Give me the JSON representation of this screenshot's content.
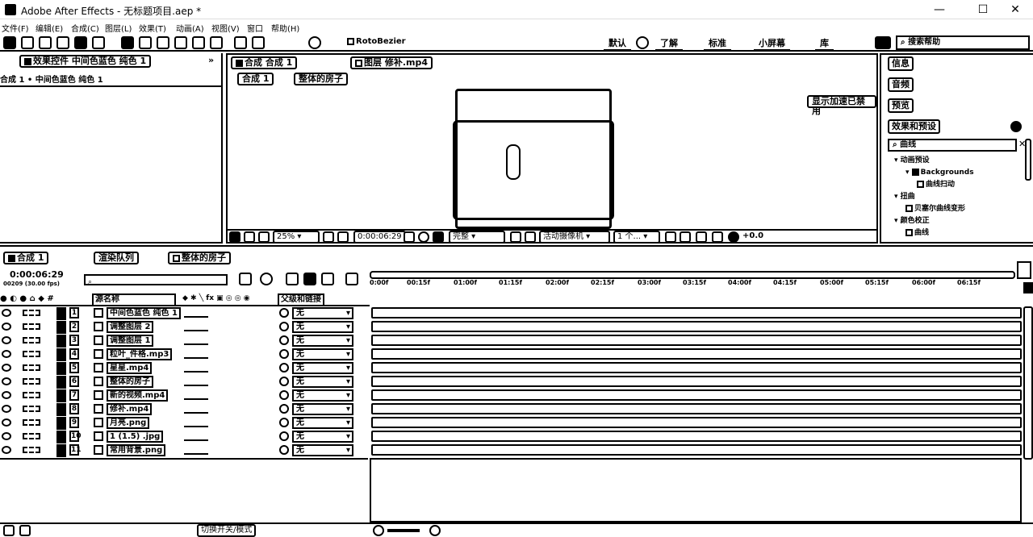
{
  "app": {
    "title": "Adobe After Effects - 无标题项目.aep *"
  },
  "window": {
    "minimize": "—",
    "maximize": "☐",
    "close": "✕"
  },
  "menu": [
    "文件(F)",
    "编辑(E)",
    "合成(C)",
    "图层(L)",
    "效果(T)",
    "动画(A)",
    "视图(V)",
    "窗口",
    "帮助(H)"
  ],
  "toolbar": {
    "rotobezier": "RotoBezier",
    "workspaces": [
      "默认",
      "了解",
      "标准",
      "小屏幕",
      "库"
    ],
    "search_help": "搜索帮助"
  },
  "effects_panel": {
    "tab": "效果控件 中间色蓝色 纯色 1",
    "breadcrumb": "合成 1 • 中间色蓝色 纯色 1"
  },
  "comp_panel": {
    "tab": "合成 合成 1",
    "footage_tab": "图层 修补.mp4",
    "sub_tab_comp": "合成 1",
    "sub_tab_layer": "整体的房子",
    "accel_notice": "显示加速已禁用",
    "zoom": "25%",
    "timecode": "0:00:06:29",
    "resolution": "完整",
    "camera": "活动摄像机",
    "views": "1 个...",
    "exposure": "+0.0"
  },
  "right_panel": {
    "items": [
      "信息",
      "音频",
      "预览",
      "效果和预设"
    ],
    "search_value": "曲线",
    "tree": [
      {
        "label": "动画预设",
        "type": "folder"
      },
      {
        "label": "Backgrounds",
        "type": "folder"
      },
      {
        "label": "曲线扫动",
        "type": "item"
      },
      {
        "label": "扭曲",
        "type": "folder"
      },
      {
        "label": "贝塞尔曲线变形",
        "type": "item"
      },
      {
        "label": "颜色校正",
        "type": "folder"
      },
      {
        "label": "曲线",
        "type": "item"
      }
    ]
  },
  "timeline": {
    "tab": "合成 1",
    "render_tab": "渲染队列",
    "house_tab": "整体的房子",
    "timecode": "0:00:06:29",
    "frames": "00209 (30.00 fps)",
    "col_source": "源名称",
    "col_parent": "父级和链接",
    "toggle": "切换开关/模式",
    "ticks": [
      "0:00f",
      "00:15f",
      "01:00f",
      "01:15f",
      "02:00f",
      "02:15f",
      "03:00f",
      "03:15f",
      "04:00f",
      "04:15f",
      "05:00f",
      "05:15f",
      "06:00f",
      "06:15f"
    ],
    "layers": [
      {
        "num": "1",
        "name": "中间色蓝色 纯色 1",
        "parent": "无"
      },
      {
        "num": "2",
        "name": "调整图层 2",
        "parent": "无"
      },
      {
        "num": "3",
        "name": "调整图层 1",
        "parent": "无"
      },
      {
        "num": "4",
        "name": "粒叶_件格.mp3",
        "parent": "无"
      },
      {
        "num": "5",
        "name": "星星.mp4",
        "parent": "无"
      },
      {
        "num": "6",
        "name": "整体的房子",
        "parent": "无"
      },
      {
        "num": "7",
        "name": "新的视频.mp4",
        "parent": "无"
      },
      {
        "num": "8",
        "name": "修补.mp4",
        "parent": "无"
      },
      {
        "num": "9",
        "name": "月亮.png",
        "parent": "无"
      },
      {
        "num": "10",
        "name": "1 (1.5) .jpg",
        "parent": "无"
      },
      {
        "num": "11",
        "name": "常用背景.png",
        "parent": "无"
      }
    ]
  }
}
